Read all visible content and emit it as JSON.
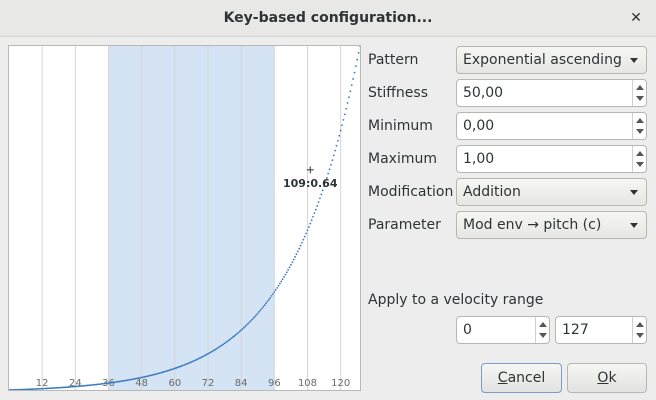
{
  "window": {
    "title": "Key-based configuration..."
  },
  "icons": {
    "close": "close-icon"
  },
  "plot": {
    "x_ticks": [
      "12",
      "24",
      "36",
      "48",
      "60",
      "72",
      "84",
      "96",
      "108",
      "120"
    ],
    "highlight_range": [
      36,
      96
    ],
    "key_min": 0,
    "key_max": 127,
    "marker": {
      "key": 109,
      "value": 0.64,
      "label": "109:0.64"
    },
    "colors": {
      "highlight": "#d4e4f4",
      "curve": "#3b78c2",
      "grid": "#d6d6d6"
    }
  },
  "form": {
    "pattern": {
      "label": "Pattern",
      "value": "Exponential ascending"
    },
    "stiffness": {
      "label": "Stiffness",
      "value": "50,00"
    },
    "minimum": {
      "label": "Minimum",
      "value": "0,00"
    },
    "maximum": {
      "label": "Maximum",
      "value": "1,00"
    },
    "modification": {
      "label": "Modification",
      "value": "Addition"
    },
    "parameter": {
      "label": "Parameter",
      "value": "Mod env → pitch (c)"
    }
  },
  "velocity": {
    "label": "Apply to a velocity range",
    "min": "0",
    "max": "127"
  },
  "buttons": {
    "cancel": {
      "mnemonic": "C",
      "rest": "ancel"
    },
    "ok": {
      "mnemonic": "O",
      "rest": "k"
    }
  }
}
